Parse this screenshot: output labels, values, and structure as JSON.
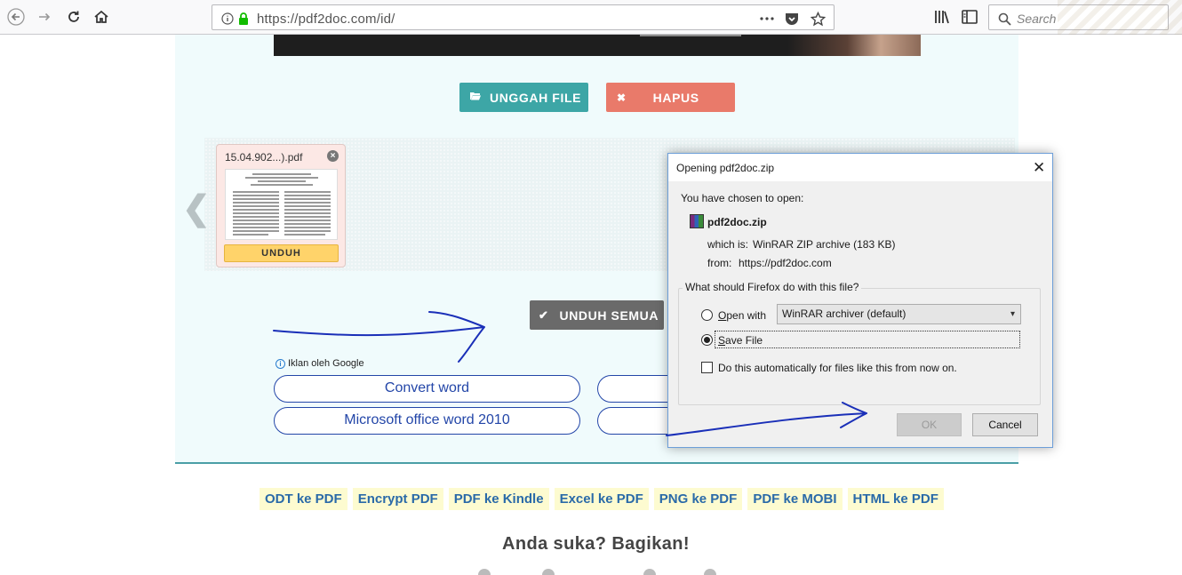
{
  "browser": {
    "url": "https://pdf2doc.com/id/",
    "search_placeholder": "Search"
  },
  "page": {
    "upload_button": "UNGGAH FILE",
    "delete_button": "HAPUS",
    "file_card": {
      "filename": "15.04.902...).pdf",
      "download_label": "UNDUH"
    },
    "download_all_button": "UNDUH SEMUA",
    "ads": {
      "label": "Iklan oleh Google",
      "items": [
        "Convert word",
        "Microsoft office word 2010"
      ]
    },
    "links": [
      "ODT ke PDF",
      "Encrypt PDF",
      "PDF ke Kindle",
      "Excel ke PDF",
      "PNG ke PDF",
      "PDF ke MOBI",
      "HTML ke PDF"
    ],
    "share_title": "Anda suka? Bagikan!"
  },
  "dialog": {
    "title": "Opening pdf2doc.zip",
    "chosen_label": "You have chosen to open:",
    "file_name": "pdf2doc.zip",
    "which_is_label": "which is:",
    "which_is_value": "WinRAR ZIP archive (183 KB)",
    "from_label": "from:",
    "from_value": "https://pdf2doc.com",
    "question": "What should Firefox do with this file?",
    "open_with_label": "Open with",
    "open_with_app": "WinRAR archiver (default)",
    "save_file_label": "Save File",
    "auto_label": "Do this automatically for files like this from now on.",
    "ok_button": "OK",
    "cancel_button": "Cancel",
    "selected_option": "Save File",
    "auto_checked": false
  },
  "colors": {
    "upload": "#3da6a6",
    "delete": "#e97a6a",
    "download_all": "#6a6a6a",
    "link": "#2a6aa8",
    "annotation": "#1a2fb8"
  }
}
